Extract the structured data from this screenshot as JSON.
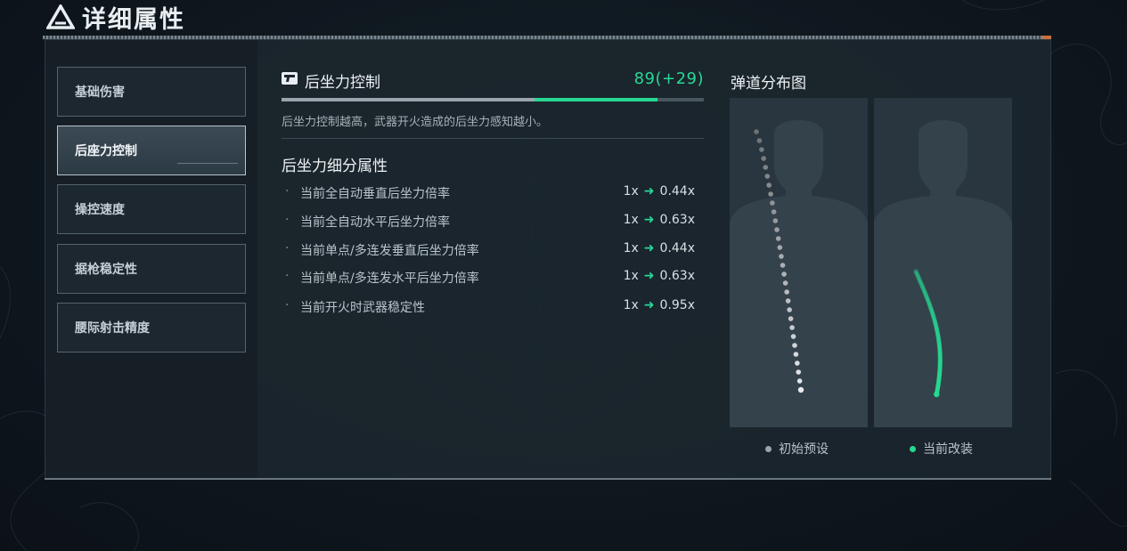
{
  "header": {
    "title": "详细属性",
    "logo_icon": "triangle-logo-icon"
  },
  "sidebar": {
    "items": [
      {
        "label": "基础伤害",
        "active": false
      },
      {
        "label": "后座力控制",
        "active": true
      },
      {
        "label": "操控速度",
        "active": false
      },
      {
        "label": "据枪稳定性",
        "active": false
      },
      {
        "label": "腰际射击精度",
        "active": false
      }
    ]
  },
  "stat": {
    "icon": "pistol-icon",
    "name": "后坐力控制",
    "value_text": "89(+29)",
    "value": 89,
    "bonus": 29,
    "bar_max": 100,
    "description": "后坐力控制越高，武器开火造成的后坐力感知越小。"
  },
  "detail": {
    "title": "后坐力细分属性",
    "rows": [
      {
        "label": "当前全自动垂直后坐力倍率",
        "from": "1x",
        "to": "0.44x"
      },
      {
        "label": "当前全自动水平后坐力倍率",
        "from": "1x",
        "to": "0.63x"
      },
      {
        "label": "当前单点/多连发垂直后坐力倍率",
        "from": "1x",
        "to": "0.44x"
      },
      {
        "label": "当前单点/多连发水平后坐力倍率",
        "from": "1x",
        "to": "0.63x"
      },
      {
        "label": "当前开火时武器稳定性",
        "from": "1x",
        "to": "0.95x"
      }
    ],
    "bullet": "·",
    "arrow_icon": "right-arrow-icon"
  },
  "ballistics": {
    "title": "弹道分布图",
    "legend": [
      {
        "label": "初始预设",
        "color": "#9aa5ab"
      },
      {
        "label": "当前改装",
        "color": "#26d891"
      }
    ]
  },
  "colors": {
    "accent_green": "#26d891",
    "value_green": "#27d896"
  }
}
